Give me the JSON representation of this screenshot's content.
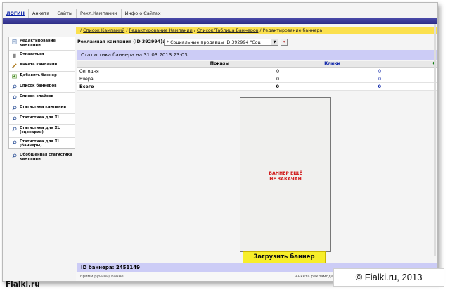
{
  "topnav": {
    "tabs": [
      "ЛОГИН",
      "Анкета",
      "Сайты",
      "Рекл.Кампании",
      "Инфо о Сайтах"
    ]
  },
  "sidebar": {
    "items": [
      {
        "label": "Редактирование кампании",
        "icon": "page-icon"
      },
      {
        "label": "Отказаться",
        "icon": "trash-icon"
      },
      {
        "label": "Анкета кампании",
        "icon": "pencil-icon"
      },
      {
        "label": "Добавить баннер",
        "icon": "add-banner-icon"
      },
      {
        "label": "Список баннеров",
        "icon": "magnifier-icon"
      },
      {
        "label": "Список слайсов",
        "icon": "magnifier-icon"
      },
      {
        "label": "Статистика кампании",
        "icon": "magnifier-icon"
      },
      {
        "label": "Статистика для XL",
        "icon": "magnifier-icon"
      },
      {
        "label": "Статистика для XL (сценарии)",
        "icon": "magnifier-icon"
      },
      {
        "label": "Статистика для XL (баннеры)",
        "icon": "magnifier-icon"
      },
      {
        "label": "Обобщённая статистика кампании",
        "icon": "magnifier-icon"
      }
    ]
  },
  "breadcrumb": {
    "items": [
      "Список Кампаний",
      "Редактирование Кампании",
      "Список/Таблица Баннеров"
    ],
    "current": "Редактирование баннера",
    "separator": "/"
  },
  "campaign": {
    "label": "Рекламная кампания (ID 392994):",
    "selected": "* Социальные продавцы ID:392994   \"Соц",
    "go_label": "»"
  },
  "stats": {
    "title": "Статистика баннера на 31.03.2013 23:03",
    "columns": [
      "",
      "Показы",
      "Клики",
      "C"
    ],
    "rows": [
      {
        "label": "Сегодня",
        "shows": "0",
        "clicks": "0"
      },
      {
        "label": "Вчера",
        "shows": "0",
        "clicks": "0"
      },
      {
        "label": "Всего",
        "shows": "0",
        "clicks": "0"
      }
    ]
  },
  "banner": {
    "placeholder_line1": "БАННЕР ЕЩЁ",
    "placeholder_line2": "НЕ ЗАКАЧАН",
    "upload_label": "Загрузить баннер",
    "id_text": "ID баннера: 2451149"
  },
  "bottom": {
    "partial_left": "прими ручной/ банне",
    "partial_right": "Анкета рекламодателя"
  },
  "watermarks": {
    "left": "Fialki.ru",
    "right": "© Fialki.ru, 2013"
  },
  "colors": {
    "nav_bar": "#2c2c86",
    "breadcrumb_bg": "#fbe04e",
    "header_band": "#ccccf6",
    "upload_button": "#f7ee2a",
    "placeholder_text": "#d11d1d",
    "link_blue": "#0a22a8"
  }
}
